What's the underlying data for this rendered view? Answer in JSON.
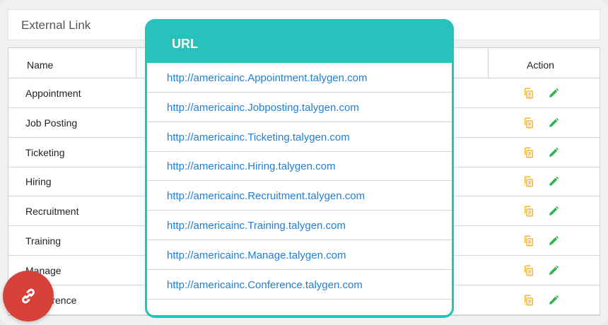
{
  "header": {
    "title": "External Link"
  },
  "table": {
    "col_name": "Name",
    "col_action": "Action",
    "rows": [
      {
        "name": "Appointment"
      },
      {
        "name": "Job Posting"
      },
      {
        "name": "Ticketing"
      },
      {
        "name": "Hiring"
      },
      {
        "name": "Recruitment"
      },
      {
        "name": "Training"
      },
      {
        "name": "Manage"
      },
      {
        "name": "Conference"
      }
    ]
  },
  "popup": {
    "title": "URL",
    "urls": [
      "http://americainc.Appointment.talygen.com",
      "http://americainc.Jobposting.talygen.com",
      "http://americainc.Ticketing.talygen.com",
      "http://americainc.Hiring.talygen.com",
      "http://americainc.Recruitment.talygen.com",
      "http://americainc.Training.talygen.com",
      "http://americainc.Manage.talygen.com",
      "http://americainc.Conference.talygen.com"
    ]
  },
  "icons": {
    "copy": "copy-icon",
    "edit": "pencil-icon",
    "fab": "link-icon"
  },
  "colors": {
    "accent": "#27c2bc",
    "link": "#1f7fd6",
    "copy_icon": "#f2b632",
    "edit_icon": "#2fb44f",
    "fab": "#d6423a"
  }
}
